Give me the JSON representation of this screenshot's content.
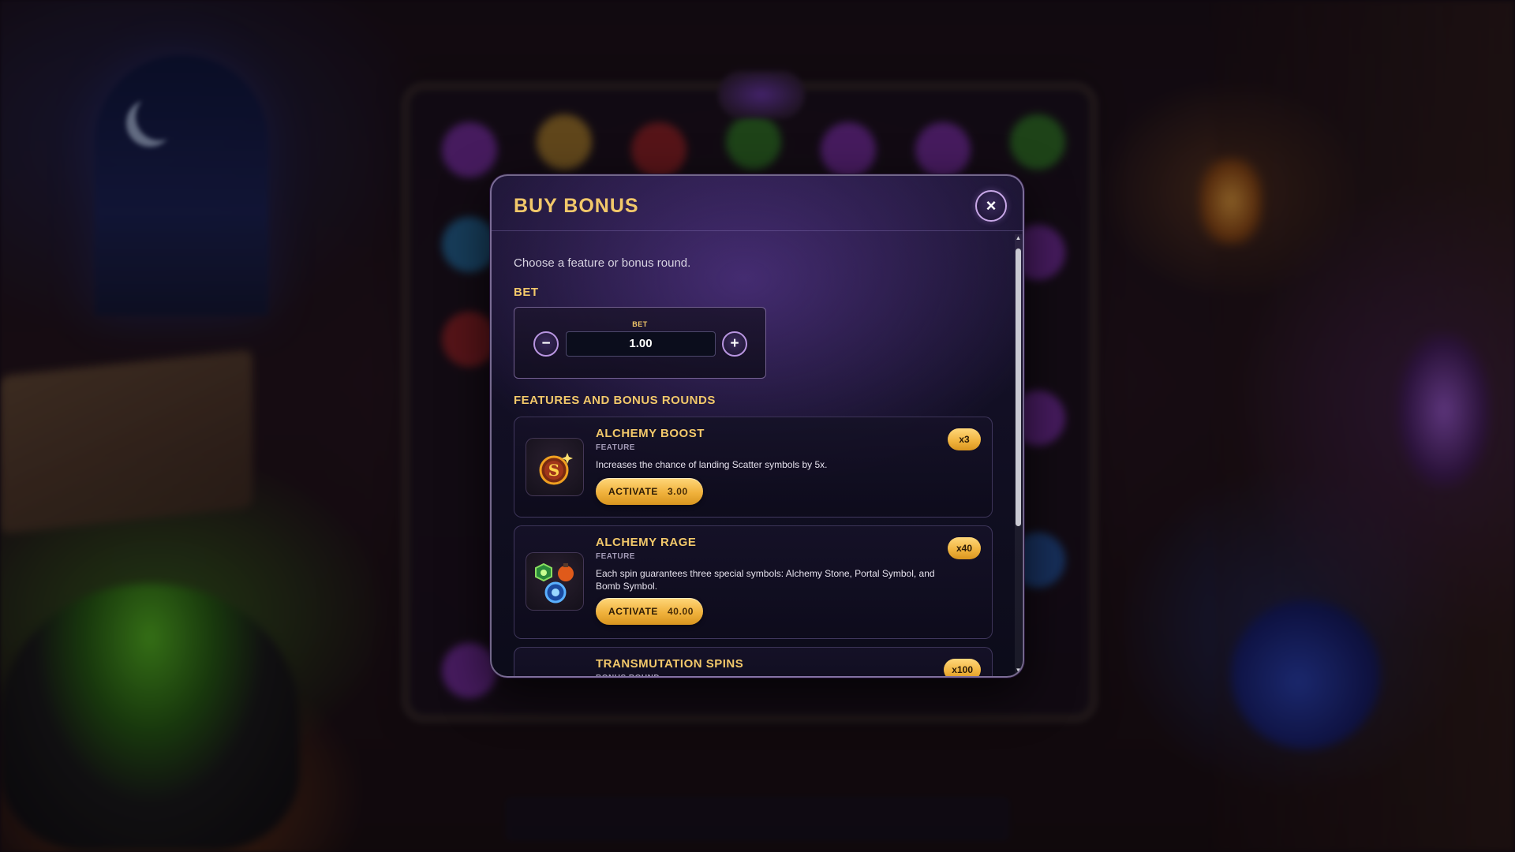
{
  "modal": {
    "title": "BUY BONUS",
    "close_icon": "×",
    "intro": "Choose a feature or bonus round.",
    "bet_heading": "BET",
    "bet": {
      "mini_label": "BET",
      "value": "1.00",
      "minus_symbol": "−",
      "plus_symbol": "+"
    },
    "features_heading": "FEATURES AND BONUS ROUNDS",
    "cards": [
      {
        "title": "ALCHEMY BOOST",
        "type": "FEATURE",
        "description": "Increases the chance of landing Scatter symbols by 5x.",
        "activate_label": "ACTIVATE",
        "price": "3.00",
        "multiplier": "x3",
        "icon": "scatter-s-symbol-icon"
      },
      {
        "title": "ALCHEMY RAGE",
        "type": "FEATURE",
        "description": "Each spin guarantees three special symbols: Alchemy Stone, Portal Symbol, and Bomb Symbol.",
        "activate_label": "ACTIVATE",
        "price": "40.00",
        "multiplier": "x40",
        "icon": "special-symbols-icon"
      },
      {
        "title": "TRANSMUTATION SPINS",
        "type": "BONUS ROUND",
        "multiplier": "x100",
        "icon": "bonus-round-icon"
      }
    ]
  },
  "colors": {
    "accent_gold": "#f2c86a",
    "button_gold": "#f0b23c",
    "panel_dark": "#120f24",
    "border_lavender": "#c9a8e8"
  }
}
